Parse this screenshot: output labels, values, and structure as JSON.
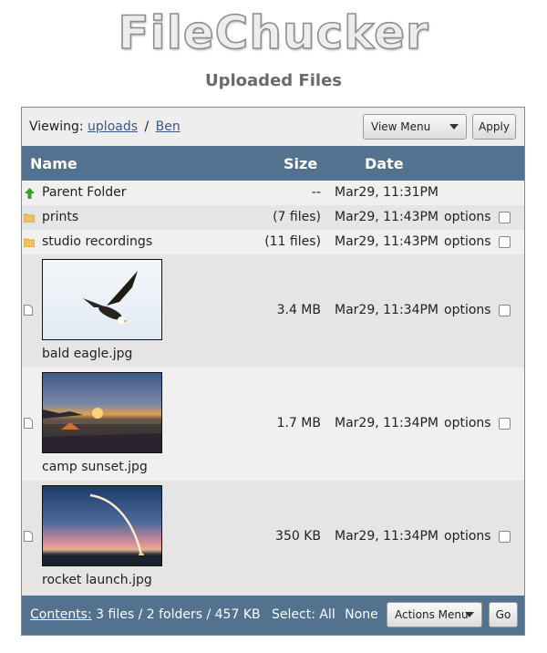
{
  "app": {
    "logo": "FileChucker",
    "subtitle": "Uploaded Files"
  },
  "viewing": {
    "label": "Viewing:",
    "path": [
      "uploads",
      "Ben"
    ],
    "separator": "/"
  },
  "toolbar": {
    "view_menu": "View Menu",
    "apply": "Apply"
  },
  "columns": {
    "name": "Name",
    "size": "Size",
    "date": "Date"
  },
  "rows": [
    {
      "name": "Parent Folder",
      "size": "--",
      "date": "Mar29, 11:31PM",
      "options": ""
    },
    {
      "name": "prints",
      "size": "(7 files)",
      "date": "Mar29, 11:43PM",
      "options": "options"
    },
    {
      "name": "studio recordings",
      "size": "(11 files)",
      "date": "Mar29, 11:43PM",
      "options": "options"
    },
    {
      "name": "bald eagle.jpg",
      "size": "3.4 MB",
      "date": "Mar29, 11:34PM",
      "options": "options"
    },
    {
      "name": "camp sunset.jpg",
      "size": "1.7 MB",
      "date": "Mar29, 11:34PM",
      "options": "options"
    },
    {
      "name": "rocket launch.jpg",
      "size": "350 KB",
      "date": "Mar29, 11:34PM",
      "options": "options"
    }
  ],
  "footer": {
    "contents_link": "Contents:",
    "contents_summary": "3 files / 2 folders / 457 KB",
    "select_label": "Select:",
    "select_all": "All",
    "select_none": "None",
    "actions_menu": "Actions Menu",
    "go": "Go"
  },
  "colors": {
    "header_bg": "#53728f",
    "link": "#3a5a85",
    "folder_icon": "#f0c060",
    "parent_arrow": "#3a9a2a"
  }
}
